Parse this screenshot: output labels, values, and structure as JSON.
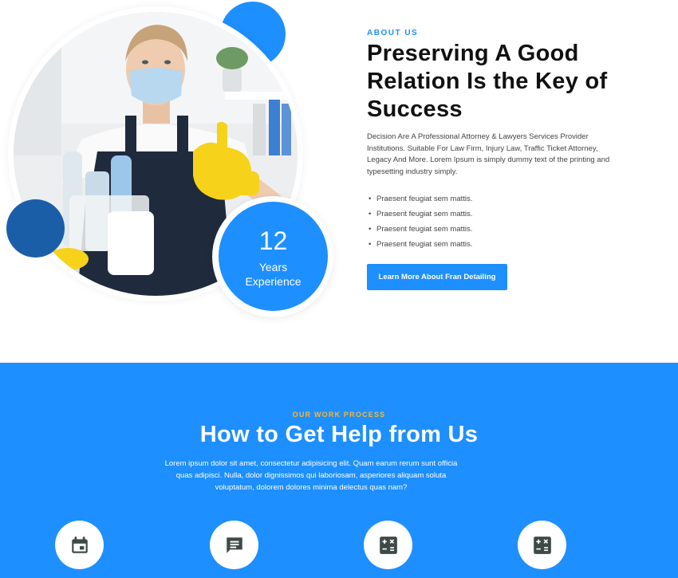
{
  "about": {
    "kicker": "ABOUT US",
    "title": "Preserving A Good Relation Is the Key of Success",
    "description": "Decision Are A Professional Attorney & Lawyers Services Provider Institutions. Suitable For Law Firm, Injury Law, Traffic Ticket Attorney, Legacy And More. Lorem Ipsum is simply dummy text of the printing and typesetting industry simply.",
    "bullets": [
      "Praesent feugiat sem mattis.",
      "Praesent feugiat sem mattis.",
      "Praesent feugiat sem mattis.",
      "Praesent feugiat sem mattis."
    ],
    "cta_label": "Learn More About Fran Detailing",
    "experience": {
      "number": "12",
      "label": "Years Experience"
    }
  },
  "process": {
    "kicker": "OUR WORK PROCESS",
    "title": "How to Get Help from Us",
    "description": "Lorem ipsum dolor sit amet, consectetur adipisicing elit. Quam earum rerum sunt officia quas adipisci. Nulla, dolor dignissimos qui laboriosam, asperiores aliquam soluta voluptatum, dolorem dolores minima delectus quas nam?",
    "steps": [
      {
        "icon": "calendar-icon"
      },
      {
        "icon": "chat-icon"
      },
      {
        "icon": "calculator-icon"
      },
      {
        "icon": "calculator-icon"
      }
    ]
  },
  "colors": {
    "accent": "#1e8fff",
    "navy": "#1b5ea8",
    "kicker_gold": "#f7b731",
    "icon_dark": "#3d4a47"
  }
}
